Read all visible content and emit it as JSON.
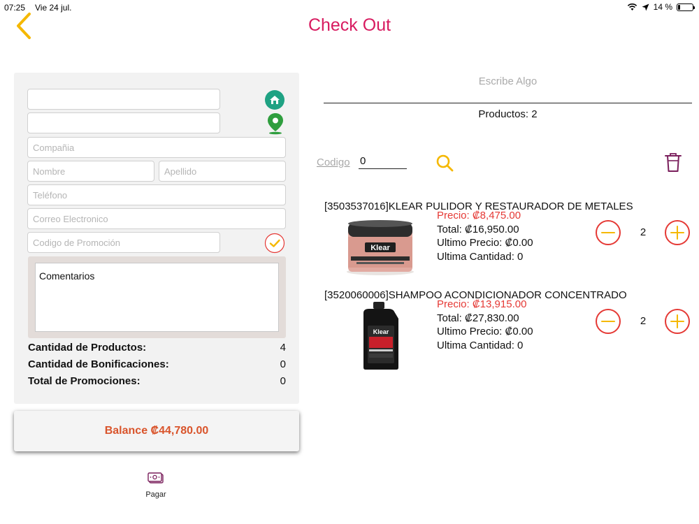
{
  "status_bar": {
    "time": "07:25",
    "date": "Vie 24 jul.",
    "battery": "14 %",
    "battery_level": 0.14
  },
  "header": {
    "title": "Check Out"
  },
  "form": {
    "field1_value": "",
    "field2_value": "",
    "company_placeholder": "Compañia",
    "first_name_placeholder": "Nombre",
    "last_name_placeholder": "Apellido",
    "phone_placeholder": "Teléfono",
    "email_placeholder": "Correo Electronico",
    "promo_placeholder": "Codigo de Promoción",
    "comments_label": "Comentarios"
  },
  "summary": [
    {
      "label": "Cantidad de Productos:",
      "value": "4"
    },
    {
      "label": "Cantidad de Bonificaciones:",
      "value": "0"
    },
    {
      "label": "Total de Promociones:",
      "value": "0"
    }
  ],
  "balance_label": "Balance ₡44,780.00",
  "pay_label": "Pagar",
  "search": {
    "placeholder": "Escribe Algo"
  },
  "products_count": "Productos: 2",
  "codigo": {
    "label": "Codigo",
    "value": "0"
  },
  "products": [
    {
      "name": "[3503537016]KLEAR PULIDOR Y RESTAURADOR DE METALES",
      "price": "Precio: ₡8,475.00",
      "total": "Total: ₡16,950.00",
      "last_price": "Ultimo Precio: ₡0.00",
      "last_qty": "Ultima Cantidad: 0",
      "qty": "2",
      "image_brand": "Klear"
    },
    {
      "name": "[3520060006]SHAMPOO ACONDICIONADOR CONCENTRADO",
      "price": "Precio: ₡13,915.00",
      "total": "Total: ₡27,830.00",
      "last_price": "Ultimo Precio: ₡0.00",
      "last_qty": "Ultima Cantidad: 0",
      "qty": "2",
      "image_brand": "Klear"
    }
  ],
  "colors": {
    "title": "#d81b60",
    "accent": "#f5b800",
    "price": "#e53935",
    "qty_buttons": "#e53935",
    "balance": "#d9542b",
    "teal_icon": "#1fa283",
    "map_icon": "#2f9e3e",
    "trash": "#7a1f5c"
  },
  "icons": [
    "chevron-left-icon",
    "house-icon",
    "map-pin-icon",
    "check-circle-icon",
    "search-icon",
    "trash-icon",
    "minus-circle-icon",
    "plus-circle-icon",
    "cash-icon",
    "wifi-icon",
    "location-arrow-icon",
    "battery-icon"
  ]
}
